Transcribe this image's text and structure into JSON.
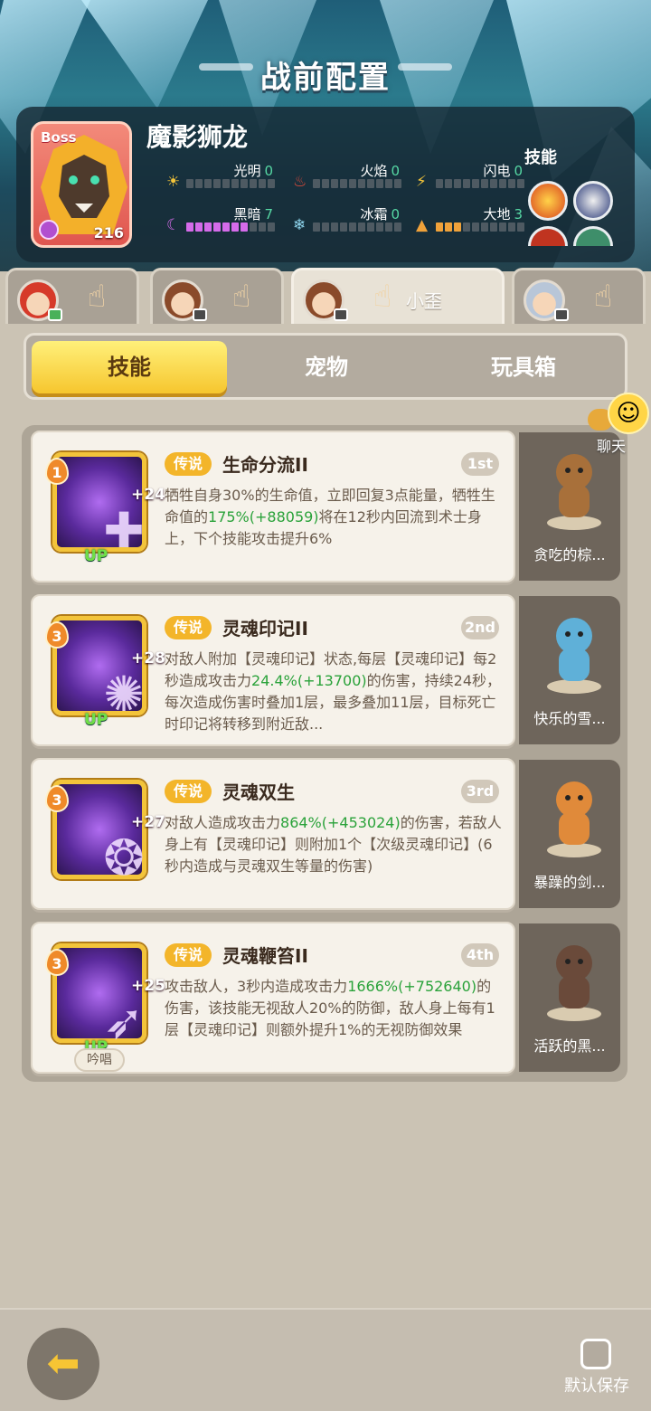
{
  "header": {
    "title": "战前配置"
  },
  "boss": {
    "tag": "Boss",
    "name": "魔影狮龙",
    "level": "216",
    "elements": [
      {
        "label": "光明",
        "value": "0",
        "level": 0,
        "color": "#f3c43a",
        "icon": "sun-icon"
      },
      {
        "label": "火焰",
        "value": "0",
        "level": 0,
        "color": "#e24a3a",
        "icon": "flame-icon"
      },
      {
        "label": "闪电",
        "value": "0",
        "level": 0,
        "color": "#f3c43a",
        "icon": "lightning-icon"
      },
      {
        "label": "黑暗",
        "value": "7",
        "level": 7,
        "color": "#d56bea",
        "icon": "moon-icon"
      },
      {
        "label": "冰霜",
        "value": "0",
        "level": 0,
        "color": "#8fd6ee",
        "icon": "snowflake-icon"
      },
      {
        "label": "大地",
        "value": "3",
        "level": 3,
        "color": "#f0a23a",
        "icon": "mountain-icon"
      }
    ],
    "skills_label": "技能"
  },
  "heroes": [
    {
      "name": "",
      "active": false
    },
    {
      "name": "",
      "active": false
    },
    {
      "name": "小歪",
      "active": true
    },
    {
      "name": "",
      "active": false
    }
  ],
  "tabs": {
    "skills": "技能",
    "pets": "宠物",
    "toybox": "玩具箱"
  },
  "chat": {
    "label": "聊天"
  },
  "skills": [
    {
      "rank": "1",
      "plus": "+24",
      "up": "UP",
      "rarity": "传说",
      "name": "生命分流II",
      "order": "1st",
      "desc_parts": [
        "牺牲自身30%的生命值，立即回复3点能量，牺牲生命值的",
        "175%(+88059)",
        "将在12秒内回流到术士身上，下个技能攻击提升6%"
      ],
      "pet": "贪吃的棕..."
    },
    {
      "rank": "3",
      "plus": "+28",
      "up": "UP",
      "rarity": "传说",
      "name": "灵魂印记II",
      "order": "2nd",
      "desc_parts": [
        "对敌人附加【灵魂印记】状态,每层【灵魂印记】每2秒造成攻击力",
        "24.4%(+13700)",
        "的伤害，持续24秒，每次造成伤害时叠加1层，最多叠加11层，目标死亡时印记将转移到附近敌..."
      ],
      "pet": "快乐的雪..."
    },
    {
      "rank": "3",
      "plus": "+27",
      "up": "",
      "rarity": "传说",
      "name": "灵魂双生",
      "order": "3rd",
      "desc_parts": [
        "对敌人造成攻击力",
        "864%(+453024)",
        "的伤害，若敌人身上有【灵魂印记】则附加1个【次级灵魂印记】(6秒内造成与灵魂双生等量的伤害)"
      ],
      "pet": "暴躁的剑..."
    },
    {
      "rank": "3",
      "plus": "+25",
      "up": "UP",
      "rarity": "传说",
      "name": "灵魂鞭笞II",
      "order": "4th",
      "desc_parts": [
        "攻击敌人，3秒内造成攻击力",
        "1666%(+752640)",
        "的伤害，该技能无视敌人20%的防御，敌人身上每有1层【灵魂印记】则额外提升1%的无视防御效果"
      ],
      "chant": "吟唱",
      "pet": "活跃的黑..."
    }
  ],
  "footer": {
    "save_label": "默认保存"
  }
}
